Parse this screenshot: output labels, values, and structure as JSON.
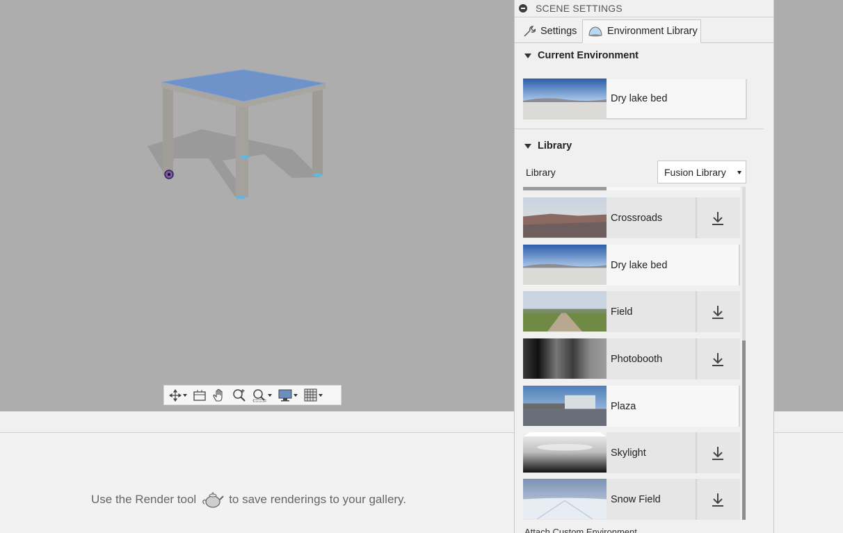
{
  "panel": {
    "title": "SCENE SETTINGS",
    "tabs": [
      {
        "label": "Settings",
        "icon": "wrench-icon"
      },
      {
        "label": "Environment Library",
        "icon": "sky-dome-icon",
        "active": true
      }
    ]
  },
  "current_environment": {
    "heading": "Current Environment",
    "name": "Dry lake bed"
  },
  "library": {
    "heading": "Library",
    "select_label": "Library",
    "select_value": "Fusion Library",
    "items": [
      {
        "name": "Crossroads",
        "downloaded": false
      },
      {
        "name": "Dry lake bed",
        "downloaded": true
      },
      {
        "name": "Field",
        "downloaded": false
      },
      {
        "name": "Photobooth",
        "downloaded": false
      },
      {
        "name": "Plaza",
        "downloaded": true
      },
      {
        "name": "Skylight",
        "downloaded": false
      },
      {
        "name": "Snow Field",
        "downloaded": false
      }
    ],
    "attach_text": "Attach Custom Environment"
  },
  "gallery": {
    "message_before": "Use the Render tool",
    "message_after": "to save renderings to your gallery."
  },
  "toolbar": {
    "items": [
      "orbit-icon",
      "look-at-icon",
      "pan-icon",
      "zoom-icon",
      "fit-icon",
      "display-settings-icon",
      "grid-icon"
    ]
  },
  "colors": {
    "viewport_bg": "#adadad",
    "table_top": "#6f93c9",
    "table_legs": "#9e9a96",
    "panel_bg": "#f0f0f0"
  }
}
